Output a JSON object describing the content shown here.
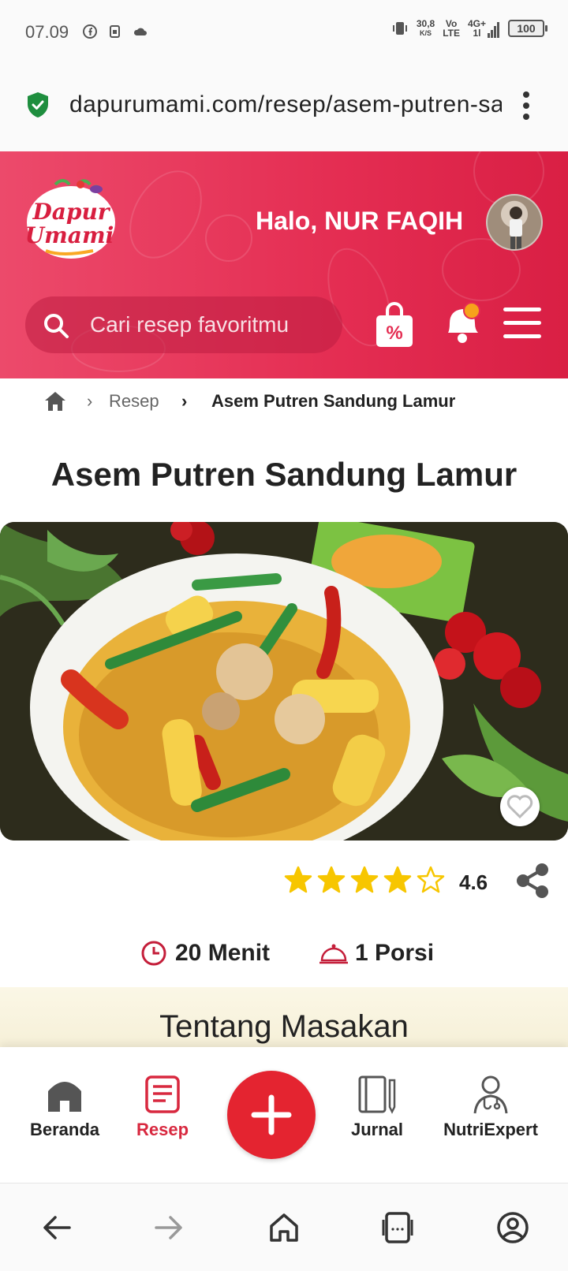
{
  "status_bar": {
    "time": "07.09",
    "speed_value": "30,8",
    "speed_unit": "K/S",
    "volte_top": "Vo",
    "volte_bottom": "LTE",
    "network_top": "4G+",
    "network_bottom": "1l",
    "battery": "100"
  },
  "browser": {
    "url": "dapurumami.com/resep/asem-putren-sandung-lamur"
  },
  "header": {
    "logo_text_1": "Dapur",
    "logo_text_2": "Umami",
    "greeting": "Halo, NUR FAQIH",
    "search_placeholder": "Cari resep favoritmu",
    "promo_label": "%"
  },
  "breadcrumb": {
    "items": [
      "Resep",
      "Asem Putren Sandung Lamur"
    ]
  },
  "recipe": {
    "title": "Asem Putren Sandung Lamur",
    "rating": "4.6",
    "rating_fraction": 0.92,
    "duration": "20 Menit",
    "portion": "1 Porsi",
    "section_title": "Tentang Masakan"
  },
  "bottom_nav": {
    "items": [
      {
        "label": "Beranda",
        "icon": "home-icon"
      },
      {
        "label": "Resep",
        "icon": "recipe-icon"
      },
      {
        "label": "Jurnal",
        "icon": "journal-icon"
      },
      {
        "label": "NutriExpert",
        "icon": "doctor-icon"
      }
    ],
    "fab_icon": "plus-icon"
  },
  "colors": {
    "brand": "#e42d52",
    "accent": "#d8283f",
    "star": "#f7c600",
    "fab": "#e42430"
  }
}
